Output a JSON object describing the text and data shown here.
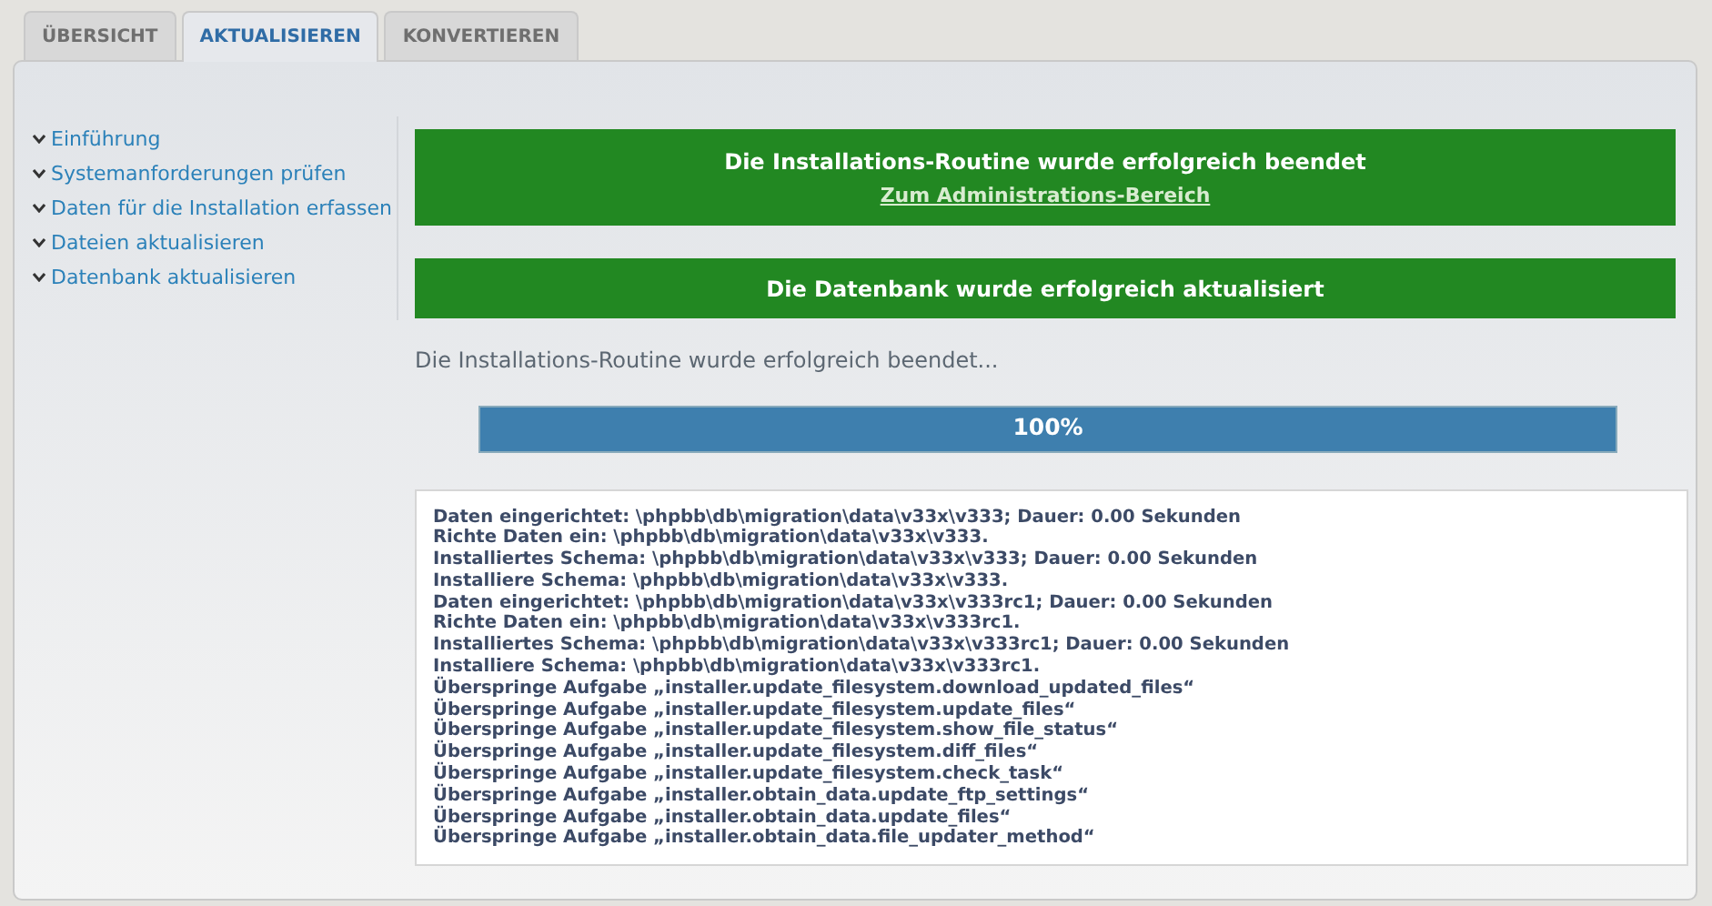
{
  "tabs": [
    {
      "label": "ÜBERSICHT",
      "selected": false
    },
    {
      "label": "AKTUALISIEREN",
      "selected": true
    },
    {
      "label": "KONVERTIEREN",
      "selected": false
    }
  ],
  "sidebar": {
    "items": [
      {
        "label": "Einführung"
      },
      {
        "label": "Systemanforderungen prüfen"
      },
      {
        "label": "Daten für die Installation erfassen"
      },
      {
        "label": "Dateien aktualisieren"
      },
      {
        "label": "Datenbank aktualisieren"
      }
    ]
  },
  "messages": [
    {
      "title": "Die Installations-Routine wurde erfolgreich beendet",
      "link": "Zum Administrations-Bereich"
    },
    {
      "title": "Die Datenbank wurde erfolgreich aktualisiert"
    }
  ],
  "status_text": "Die Installations-Routine wurde erfolgreich beendet...",
  "progress": {
    "level": 1,
    "reading": "100%"
  },
  "log": [
    "Daten eingerichtet: \\phpbb\\db\\migration\\data\\v33x\\v333; Dauer: 0.00 Sekunden",
    "Richte Daten ein: \\phpbb\\db\\migration\\data\\v33x\\v333.",
    "Installiertes Schema: \\phpbb\\db\\migration\\data\\v33x\\v333; Dauer: 0.00 Sekunden",
    "Installiere Schema: \\phpbb\\db\\migration\\data\\v33x\\v333.",
    "Daten eingerichtet: \\phpbb\\db\\migration\\data\\v33x\\v333rc1; Dauer: 0.00 Sekunden",
    "Richte Daten ein: \\phpbb\\db\\migration\\data\\v33x\\v333rc1.",
    "Installiertes Schema: \\phpbb\\db\\migration\\data\\v33x\\v333rc1; Dauer: 0.00 Sekunden",
    "Installiere Schema: \\phpbb\\db\\migration\\data\\v33x\\v333rc1.",
    "Überspringe Aufgabe „installer.update_filesystem.download_updated_files“",
    "Überspringe Aufgabe „installer.update_filesystem.update_files“",
    "Überspringe Aufgabe „installer.update_filesystem.show_file_status“",
    "Überspringe Aufgabe „installer.update_filesystem.diff_files“",
    "Überspringe Aufgabe „installer.update_filesystem.check_task“",
    "Überspringe Aufgabe „installer.obtain_data.update_ftp_settings“",
    "Überspringe Aufgabe „installer.obtain_data.update_files“",
    "Überspringe Aufgabe „installer.obtain_data.file_updater_method“"
  ]
}
